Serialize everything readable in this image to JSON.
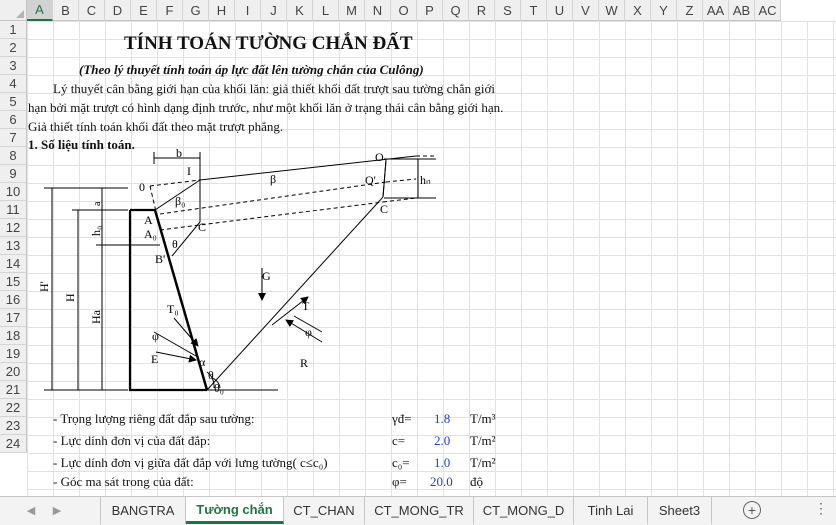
{
  "columns": [
    "A",
    "B",
    "C",
    "D",
    "E",
    "F",
    "G",
    "H",
    "I",
    "J",
    "K",
    "L",
    "M",
    "N",
    "O",
    "P",
    "Q",
    "R",
    "S",
    "T",
    "U",
    "V",
    "W",
    "X",
    "Y",
    "Z",
    "AA",
    "AB",
    "AC"
  ],
  "rows": [
    "1",
    "2",
    "3",
    "4",
    "5",
    "6",
    "7",
    "8",
    "9",
    "10",
    "11",
    "12",
    "13",
    "14",
    "15",
    "16",
    "17",
    "18",
    "19",
    "20",
    "21",
    "22",
    "23",
    "24"
  ],
  "sheet": {
    "title": "TÍNH TOÁN TƯỜNG CHẮN ĐẤT",
    "subtitle": "(Theo lý thuyết tính toán áp lực đất lên tường chắn của Culông)",
    "line3": "Lý thuyết cân bằng giới hạn của khối lăn: giả thiết khối đất trượt sau tường chắn giới",
    "line4": "hạn bởi mặt trượt có hình dạng định trước, như một khối lăn ở trạng thái cân bằng giới hạn.",
    "line5": "Giả thiết tính toán khối đất theo mặt trượt phẳng.",
    "section1": "1. Số liệu tính toán.",
    "params": [
      {
        "label": "- Trọng lượng riêng đất đắp sau tường:",
        "symbol": "γđ=",
        "value": "1.8",
        "unit": "T/m³"
      },
      {
        "label": "- Lực dính đơn vị của đất đắp:",
        "symbol": "c=",
        "value": "2.0",
        "unit": "T/m²"
      },
      {
        "label": "- Lực dính đơn vị giữa đất đắp với lưng tường( c≤c₀)",
        "symbol": "c₀=",
        "value": "1.0",
        "unit": "T/m²"
      },
      {
        "label": "- Góc ma sát trong của đất:",
        "symbol": "φ=",
        "value": "20.0",
        "unit": "độ"
      }
    ]
  },
  "diagram_labels": {
    "b": "b",
    "O0": "0",
    "I": "I",
    "beta": "β",
    "O": "O",
    "Qp": "Q'",
    "hn": "hₙ",
    "A": "A",
    "beta0": "β₀",
    "C": "C",
    "Cr": "C",
    "A0": "A₀",
    "h0": "h₀",
    "a": "a",
    "theta": "θ",
    "Bp": "B'",
    "G": "G",
    "H": "H",
    "Hp": "H'",
    "Ha": "Ha",
    "T0": "T₀",
    "T": "T",
    "phi1": "φ",
    "phi2": "φ",
    "E": "E",
    "R": "R",
    "alpha": "α",
    "theta2": "θ",
    "theta0": "θ₀"
  },
  "tabs": [
    {
      "label": "BANGTRA",
      "active": false
    },
    {
      "label": "Tường chắn",
      "active": true
    },
    {
      "label": "CT_CHAN",
      "active": false
    },
    {
      "label": "CT_MONG_TR",
      "active": false
    },
    {
      "label": "CT_MONG_D",
      "active": false
    },
    {
      "label": "Tinh Lai",
      "active": false
    },
    {
      "label": "Sheet3",
      "active": false
    }
  ],
  "tab_icons": {
    "prev": "chevron-left-icon",
    "next": "chevron-right-icon",
    "add": "plus-icon",
    "more": "more-icon"
  }
}
